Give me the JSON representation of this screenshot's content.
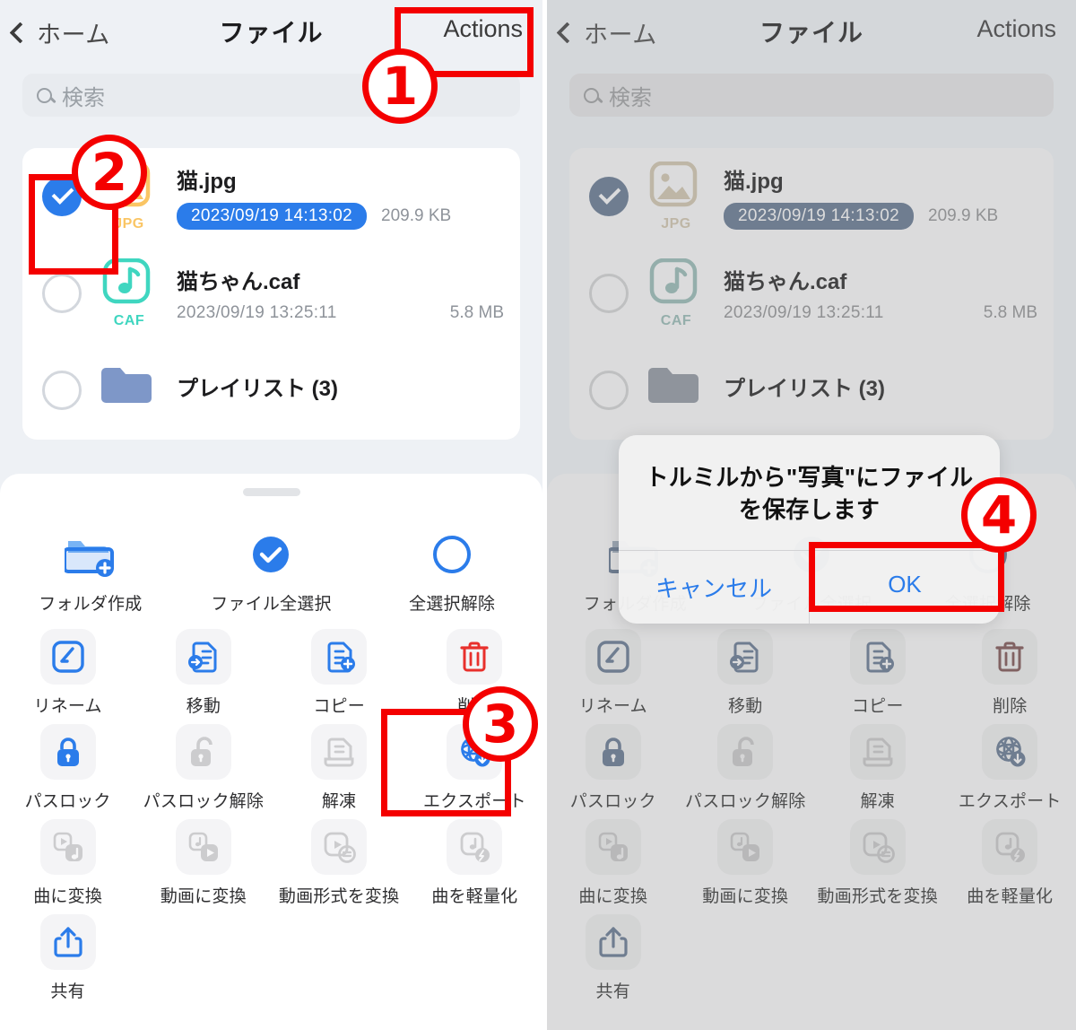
{
  "nav": {
    "back_label": "ホーム",
    "title": "ファイル",
    "action_label": "Actions"
  },
  "search": {
    "placeholder": "検索"
  },
  "files": [
    {
      "name": "猫.jpg",
      "type": "JPG",
      "date": "2023/09/19 14:13:02",
      "size": "209.9 KB",
      "selected": true,
      "date_highlighted": true
    },
    {
      "name": "猫ちゃん.caf",
      "type": "CAF",
      "date": "2023/09/19 13:25:11",
      "size": "5.8 MB",
      "selected": false,
      "date_highlighted": false
    },
    {
      "name": "プレイリスト (3)",
      "type": "FOLDER",
      "date": "",
      "size": "",
      "selected": false,
      "date_highlighted": false
    }
  ],
  "sheet": {
    "row_top": [
      {
        "label": "フォルダ作成",
        "icon": "folder-add-icon",
        "enabled": true
      },
      {
        "label": "ファイル全選択",
        "icon": "check-circle-icon",
        "enabled": true
      },
      {
        "label": "全選択解除",
        "icon": "empty-circle-icon",
        "enabled": true
      }
    ],
    "grid": [
      {
        "label": "リネーム",
        "icon": "rename-icon",
        "enabled": true
      },
      {
        "label": "移動",
        "icon": "move-file-icon",
        "enabled": true
      },
      {
        "label": "コピー",
        "icon": "copy-file-icon",
        "enabled": true
      },
      {
        "label": "削除",
        "icon": "trash-icon",
        "enabled": true
      },
      {
        "label": "パスロック",
        "icon": "lock-icon",
        "enabled": true
      },
      {
        "label": "パスロック解除",
        "icon": "unlock-icon",
        "enabled": false
      },
      {
        "label": "解凍",
        "icon": "unzip-icon",
        "enabled": false
      },
      {
        "label": "エクスポート",
        "icon": "export-icon",
        "enabled": true
      },
      {
        "label": "曲に変換",
        "icon": "to-audio-icon",
        "enabled": false
      },
      {
        "label": "動画に変換",
        "icon": "to-video-icon",
        "enabled": false
      },
      {
        "label": "動画形式を変換",
        "icon": "convert-video-format-icon",
        "enabled": false
      },
      {
        "label": "曲を軽量化",
        "icon": "compress-audio-icon",
        "enabled": false
      },
      {
        "label": "共有",
        "icon": "share-icon",
        "enabled": true
      }
    ]
  },
  "alert": {
    "title": "トルミルから\"写真\"にファイルを保存します",
    "cancel_label": "キャンセル",
    "ok_label": "OK"
  },
  "annotations": {
    "step1": "1",
    "step2": "2",
    "step3": "3",
    "step4": "4"
  },
  "colors": {
    "accent_blue": "#2b7cea",
    "annotation_red": "#f40000",
    "danger_red": "#e8302c",
    "jpg_amber": "#fac564",
    "caf_teal": "#3fd6c0",
    "folder_blue": "#7e97c8",
    "page_bg": "#eef1f5",
    "card_white": "#ffffff"
  }
}
